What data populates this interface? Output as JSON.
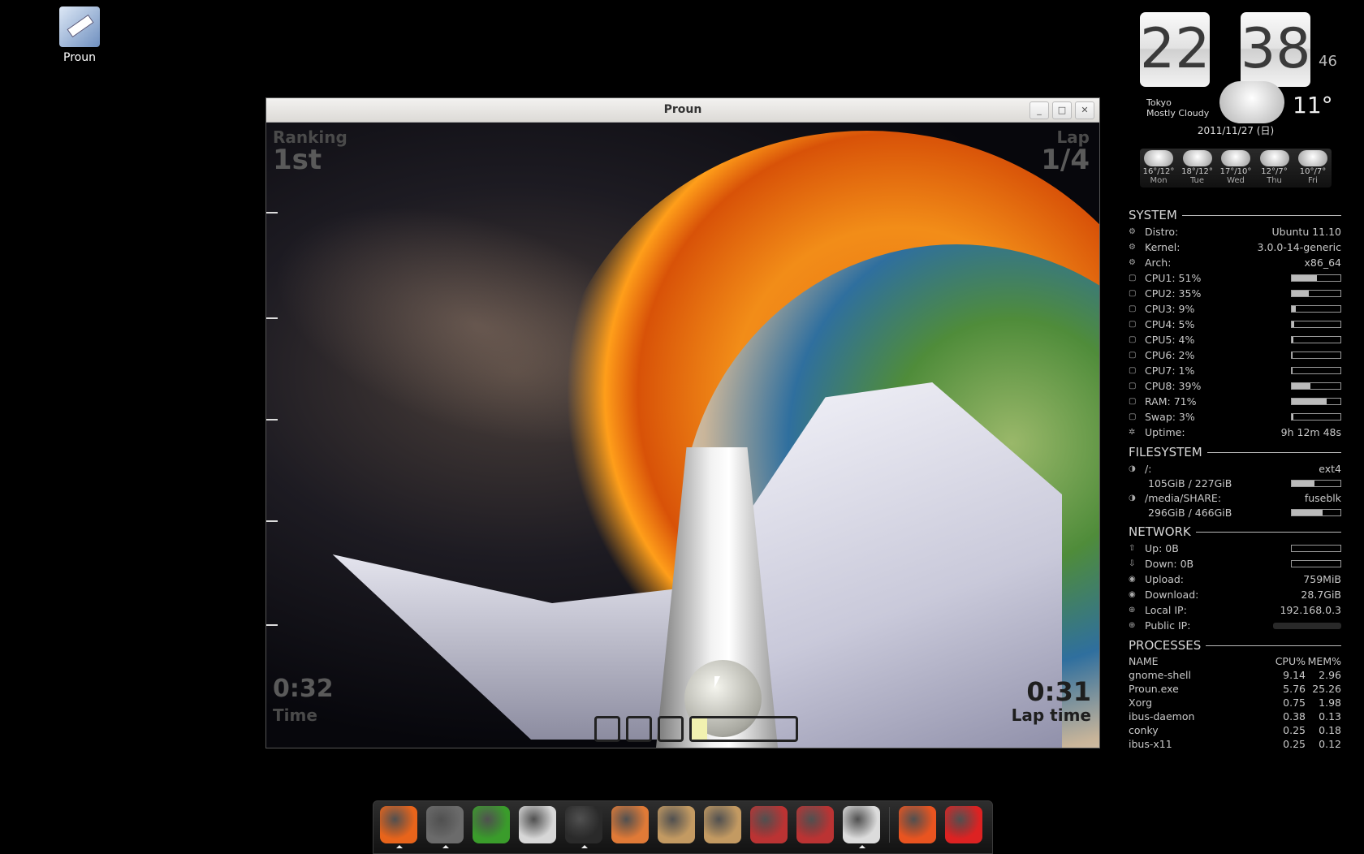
{
  "desktop": {
    "icon_label": "Proun"
  },
  "window": {
    "title": "Proun",
    "buttons": {
      "minimize": "_",
      "maximize": "□",
      "close": "✕"
    }
  },
  "game": {
    "ranking_label": "Ranking",
    "ranking_value": "1st",
    "lap_label": "Lap",
    "lap_value": "1/4",
    "time_value": "0:32",
    "time_label": "Time",
    "lap_time_value": "0:31",
    "lap_time_label": "Lap time",
    "progress_fraction": 0.15
  },
  "clock": {
    "hours": "22",
    "minutes": "38",
    "seconds": "46",
    "city": "Tokyo",
    "condition": "Mostly Cloudy",
    "temp": "11°",
    "date": "2011/11/27 (日)",
    "forecast": [
      {
        "temps": "16°/12°",
        "day": "Mon"
      },
      {
        "temps": "18°/12°",
        "day": "Tue"
      },
      {
        "temps": "17°/10°",
        "day": "Wed"
      },
      {
        "temps": "12°/7°",
        "day": "Thu"
      },
      {
        "temps": "10°/7°",
        "day": "Fri"
      }
    ]
  },
  "conky": {
    "system": {
      "title": "SYSTEM",
      "distro_k": "Distro:",
      "distro_v": "Ubuntu 11.10",
      "kernel_k": "Kernel:",
      "kernel_v": "3.0.0-14-generic",
      "arch_k": "Arch:",
      "arch_v": "x86_64",
      "cpus": [
        {
          "label": "CPU1: 51%",
          "level": 51
        },
        {
          "label": "CPU2: 35%",
          "level": 35
        },
        {
          "label": "CPU3: 9%",
          "level": 9
        },
        {
          "label": "CPU4: 5%",
          "level": 5
        },
        {
          "label": "CPU5: 4%",
          "level": 4
        },
        {
          "label": "CPU6: 2%",
          "level": 2
        },
        {
          "label": "CPU7: 1%",
          "level": 1
        },
        {
          "label": "CPU8: 39%",
          "level": 39
        },
        {
          "label": "RAM: 71%",
          "level": 71
        },
        {
          "label": "Swap: 3%",
          "level": 3
        }
      ],
      "uptime_k": "Uptime:",
      "uptime_v": "9h 12m 48s"
    },
    "filesystem": {
      "title": "FILESYSTEM",
      "root_k": "/:",
      "root_v": "ext4",
      "root_usage": "105GiB / 227GiB",
      "root_level": 46,
      "share_k": "/media/SHARE:",
      "share_v": "fuseblk",
      "share_usage": "296GiB / 466GiB",
      "share_level": 64
    },
    "network": {
      "title": "NETWORK",
      "up_k": "Up: 0B",
      "down_k": "Down: 0B",
      "upload_k": "Upload:",
      "upload_v": "759MiB",
      "download_k": "Download:",
      "download_v": "28.7GiB",
      "local_k": "Local IP:",
      "local_v": "192.168.0.3",
      "public_k": "Public IP:"
    },
    "processes": {
      "title": "PROCESSES",
      "h_name": "NAME",
      "h_cpu": "CPU%",
      "h_mem": "MEM%",
      "rows": [
        {
          "name": "gnome-shell",
          "cpu": "9.14",
          "mem": "2.96"
        },
        {
          "name": "Proun.exe",
          "cpu": "5.76",
          "mem": "25.26"
        },
        {
          "name": "Xorg",
          "cpu": "0.75",
          "mem": "1.98"
        },
        {
          "name": "ibus-daemon",
          "cpu": "0.38",
          "mem": "0.13"
        },
        {
          "name": "conky",
          "cpu": "0.25",
          "mem": "0.18"
        },
        {
          "name": "ibus-x11",
          "cpu": "0.25",
          "mem": "0.12"
        }
      ]
    }
  },
  "dock": {
    "items": [
      {
        "name": "firefox",
        "color": "#e8641b"
      },
      {
        "name": "pidgin",
        "color": "#6b6b6b"
      },
      {
        "name": "windows",
        "color": "#3a9c2b"
      },
      {
        "name": "text-editor",
        "color": "#d7d7d7"
      },
      {
        "name": "terminal",
        "color": "#2a2a2a"
      },
      {
        "name": "home-folder",
        "color": "#e07a37"
      },
      {
        "name": "upload",
        "color": "#c39a62"
      },
      {
        "name": "download",
        "color": "#c39a62"
      },
      {
        "name": "settings",
        "color": "#b33"
      },
      {
        "name": "system-tools",
        "color": "#b33"
      },
      {
        "name": "window",
        "color": "#dcdcdc"
      },
      {
        "name": "ubuntu",
        "color": "#e95420"
      },
      {
        "name": "shutdown",
        "color": "#d22"
      }
    ]
  }
}
